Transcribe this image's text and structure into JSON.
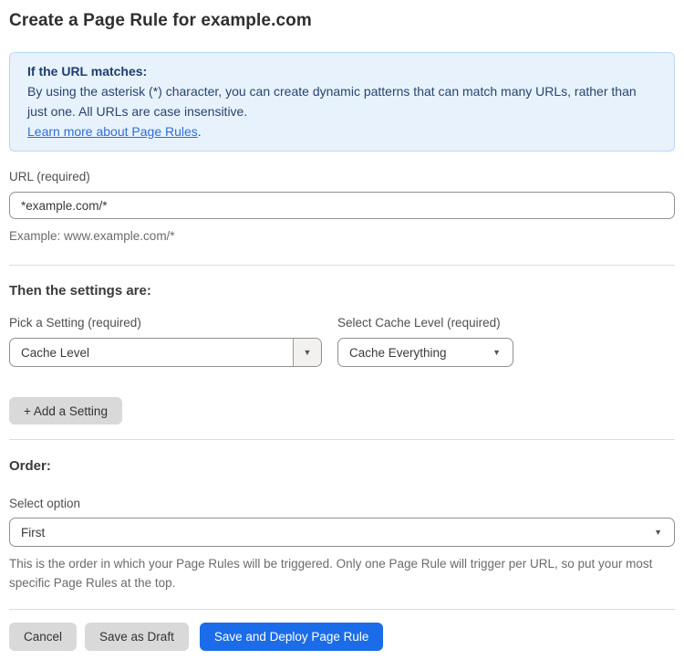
{
  "page": {
    "title": "Create a Page Rule for example.com"
  },
  "info_box": {
    "heading": "If the URL matches:",
    "body": "By using the asterisk (*) character, you can create dynamic patterns that can match many URLs, rather than just one. All URLs are case insensitive.",
    "link": "Learn more about Page Rules",
    "link_suffix": "."
  },
  "url_field": {
    "label": "URL (required)",
    "value": "*example.com/*",
    "helper": "Example: www.example.com/*"
  },
  "settings_section": {
    "heading": "Then the settings are:",
    "setting_picker": {
      "label": "Pick a Setting (required)",
      "value": "Cache Level"
    },
    "cache_level_picker": {
      "label": "Select Cache Level (required)",
      "value": "Cache Everything"
    },
    "add_setting_button": "+ Add a Setting"
  },
  "order_section": {
    "heading": "Order:",
    "label": "Select option",
    "value": "First",
    "helper": "This is the order in which your Page Rules will be triggered. Only one Page Rule will trigger per URL, so put your most specific Page Rules at the top."
  },
  "footer": {
    "cancel_label": "Cancel",
    "save_draft_label": "Save as Draft",
    "save_deploy_label": "Save and Deploy Page Rule"
  },
  "icons": {
    "dropdown_arrow": "▼"
  },
  "colors": {
    "accent_blue": "#1a6ce8",
    "info_background": "#e8f2fc",
    "info_border": "#b9d8f3",
    "info_text": "#1f3d6d",
    "link_blue": "#2f6fd4",
    "button_gray": "#d9d9d9"
  }
}
